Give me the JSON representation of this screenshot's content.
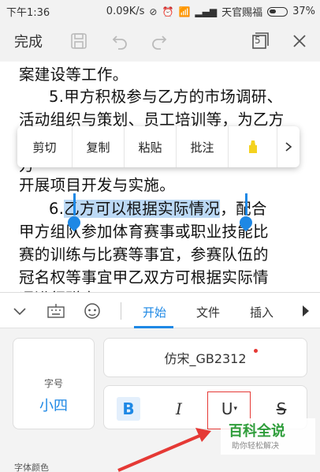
{
  "status_bar": {
    "time": "下午1:36",
    "speed": "0.09K/s",
    "carrier": "天官赐福",
    "battery": "37%"
  },
  "toolbar": {
    "done_label": "完成",
    "tabs_count": "5"
  },
  "document": {
    "lines": [
      "案建设等工作。",
      "5.甲方积极参与乙方的市场调研、",
      "活动组织与策划、员工培训等，为乙方",
      "开展项目开发与实施。",
      "6.",
      "乙方可以根据实际情况",
      "，配合",
      "甲方组队参加体育赛事或职业技能比",
      "赛的训练与比赛等事宜，参赛队伍的",
      "冠名权等事宜甲乙双方可根据实际情",
      "况进行磋商"
    ],
    "partial_lines": [
      "拓",
      "方"
    ]
  },
  "context_menu": {
    "items": [
      "剪切",
      "复制",
      "粘贴",
      "批注"
    ]
  },
  "ribbon": {
    "tabs": [
      "开始",
      "文件",
      "插入"
    ],
    "active_tab": "开始"
  },
  "panel": {
    "size_label": "字号",
    "size_value": "小四",
    "font_name": "仿宋_GB2312",
    "bold": "B",
    "italic": "I",
    "underline": "U",
    "strike": "S",
    "font_color_label": "字体颜色"
  },
  "watermark": {
    "title": "百科全说",
    "subtitle": "助你轻松解决"
  },
  "colors": {
    "accent": "#1e88e5",
    "highlight": "#bcd9f5",
    "annotation": "#e53935",
    "watermark": "#2e9d3a"
  }
}
